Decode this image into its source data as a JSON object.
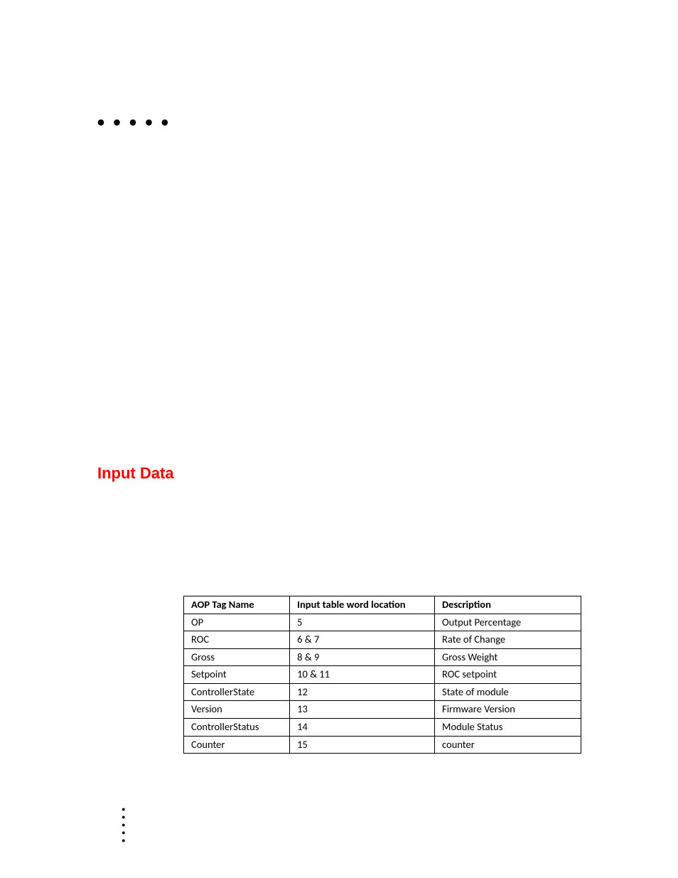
{
  "decor": {
    "top_dots": "• • • • •",
    "side_dot": "•"
  },
  "heading": "Input Data",
  "table": {
    "headers": {
      "tag": "AOP Tag Name",
      "loc": "Input table word location",
      "desc": "Description"
    },
    "rows": [
      {
        "tag": "OP",
        "loc": "5",
        "desc": "Output Percentage"
      },
      {
        "tag": "ROC",
        "loc": "6 & 7",
        "desc": "Rate of Change"
      },
      {
        "tag": "Gross",
        "loc": "8 & 9",
        "desc": "Gross Weight"
      },
      {
        "tag": "Setpoint",
        "loc": "10 & 11",
        "desc": "ROC setpoint"
      },
      {
        "tag": "ControllerState",
        "loc": "12",
        "desc": "State of module"
      },
      {
        "tag": "Version",
        "loc": "13",
        "desc": "Firmware Version"
      },
      {
        "tag": "ControllerStatus",
        "loc": "14",
        "desc": "Module Status"
      },
      {
        "tag": "Counter",
        "loc": "15",
        "desc": "counter"
      }
    ]
  }
}
